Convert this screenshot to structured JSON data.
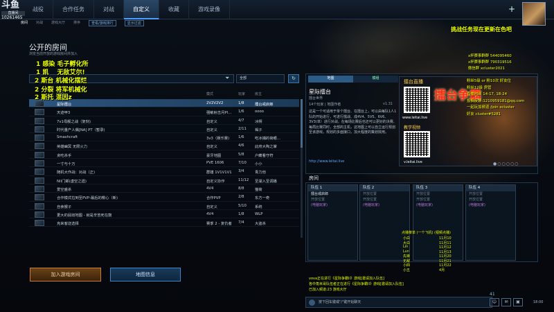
{
  "top": {
    "logo": "斗鱼",
    "logo_sub": "直播间",
    "uid": "10261465",
    "tabs": [
      "战役",
      "合作任务",
      "对战",
      "自定义",
      "收藏",
      "游戏录像"
    ],
    "plus": "+",
    "mission_banner": "挑战任务现在更新在色吧"
  },
  "subnav": [
    "房间",
    "对战",
    "游戏大厅",
    "排序",
    "查看/游戏排行",
    "显示过滤"
  ],
  "page": {
    "title": "公开的房间",
    "subtitle": "浏览当前开放的游戏房间并加入",
    "search_placeholder": "",
    "filter_select": "全部",
    "refresh": "↻"
  },
  "overlay_list": [
    "1 感染 毛子孵化所",
    "1 凯　 无敌艾尔!",
    "2 斯台 机械化摆烂",
    "2 分裂 将军机械化",
    "2 斯托 混因z"
  ],
  "columns": {
    "name": "名称",
    "mode": "模式",
    "players": "玩家",
    "host": "房主"
  },
  "rooms": [
    {
      "name": "星际擂台",
      "mode": "2V2V2V2",
      "players": "1/8",
      "host": "擂台戒启郎"
    },
    {
      "name": "天迹甲3",
      "mode": "强敏射击月Pl…",
      "players": "1/6",
      "host": "oooo"
    },
    {
      "name": "7v1母舰之战（复刻)",
      "mode": "自定义",
      "players": "4/7",
      "host": "冰朔"
    },
    {
      "name": "时代量产人偶[NA] PT（暂录)",
      "mode": "自定义",
      "players": "2/11",
      "host": "褐子"
    },
    {
      "name": "Smashcraft",
      "mode": "3v3（娱乐赛)",
      "players": "1/6",
      "host": "吃冰捕的荷眼…"
    },
    {
      "name": "英雄幽冥 无限火力",
      "mode": "自定义",
      "players": "4/6",
      "host": "此府大陶之掌"
    },
    {
      "name": "贪吃杀手",
      "mode": "豪牙地图",
      "players": "5/8",
      "host": "户藏看守符"
    },
    {
      "name": "一寸与十万",
      "mode": "PVE 1606",
      "players": "7/10",
      "host": "小小"
    },
    {
      "name": "随机大作战：对战（正)",
      "mode": "群雄 1V1V1V1",
      "players": "3/4",
      "host": "青力他"
    },
    {
      "name": "NII门邮(虚空之遗)",
      "mode": "自定义协作",
      "players": "11/12",
      "host": "至湖入至调播"
    },
    {
      "name": "爱空盛杀",
      "mode": "4V4",
      "players": "8/8",
      "host": "猫荷"
    },
    {
      "name": "合作模式拉到至PVP-最后的樱心（新)",
      "mode": "合作PVP",
      "players": "2/8",
      "host": "东方一奇"
    },
    {
      "name": "自食猴子",
      "mode": "自定义",
      "players": "5/10",
      "host": "系统"
    },
    {
      "name": "更大的屁歧地图 - 就是辛苦死在鼓",
      "mode": "4V4",
      "players": "1/8",
      "host": "WLP"
    },
    {
      "name": "克来客迩选择",
      "mode": "赛季 2 - 复仇者",
      "players": "7/4",
      "host": "大盗杀"
    }
  ],
  "buttons": {
    "join": "加入游戏房间",
    "map_info": "地图信息"
  },
  "detail": {
    "tab_map": "地图",
    "tab_mods": "模组",
    "title": "星际擂台",
    "subtitle": "擂台世界",
    "host": "14个玩家 | 地图作者",
    "version": "v1.31",
    "desc": "这是一个可适用于单个擂台、在擂台上，可以由每队1人1队的开始进行，可进行擂战、成4V4、5V5、6V6、3V3(单）进行对战，在每场比赛后也还可以更好的决赛、每局比赛同时，全部的主机，这地图上可以自立运行规划至该游戏，规划的多面接口，加大程度的策划效用。",
    "link": "http://www.leitai.live"
  },
  "ad": {
    "live": "擂台直播",
    "big": "擂台争霸",
    "url1": "www.leitai.live",
    "teach": "教学视频",
    "url2": "v.leitai.live"
  },
  "lobby": {
    "label": "房间",
    "teams": [
      {
        "title": "队伍 1",
        "slots": [
          "擂台戒启郎",
          "开放位置",
          "(电脑玩家)"
        ]
      },
      {
        "title": "队伍 2",
        "slots": [
          "开放位置",
          "开放位置",
          "(电脑玩家)"
        ]
      },
      {
        "title": "队伍 3",
        "slots": [
          "开放位置",
          "开放位置",
          "(电脑玩家)"
        ]
      },
      {
        "title": "队伍 4",
        "slots": [
          "开放位置",
          "开放位置",
          "(电脑玩家)"
        ]
      }
    ]
  },
  "chat": {
    "placeholder": "按下回车键或\"/\"键开始聊天",
    "count": "41",
    "time": "18:00"
  },
  "stream_overlay": {
    "info": [
      "x杯赛事群群 544095460",
      "x杯赛事群群 790319516",
      "微信群 xcluster2021"
    ],
    "schedule": [
      "粉丝5级 or 粉10次 好友位",
      "粉丝12级 房管",
      "直播时间 14-17, 18-24",
      "投稿反馈:1210959181@qq.com",
      "一起玩加频道 /join xcluster",
      "好友 cluster#5281"
    ],
    "bottom_left": [
      "vova正在进行《星际争霸II》游戏[邀请加入队伍]",
      "各中角米哥队伍者正在进行《星际争霸II》游戏[邀请加入队伍]",
      "已加入频道:23 游戏大厅"
    ],
    "board_title": "点播菜单 (一个飞机) (视频点播)",
    "board": [
      [
        "小白",
        "11月10"
      ],
      [
        "大白",
        "11月11"
      ],
      [
        "Lin",
        "11月12"
      ],
      [
        "Lvn",
        "11月13"
      ],
      [
        "先锋",
        "11月20"
      ],
      [
        "无敌",
        "11月21"
      ],
      [
        "小四",
        "11月22"
      ],
      [
        "小五",
        "4月"
      ]
    ]
  }
}
